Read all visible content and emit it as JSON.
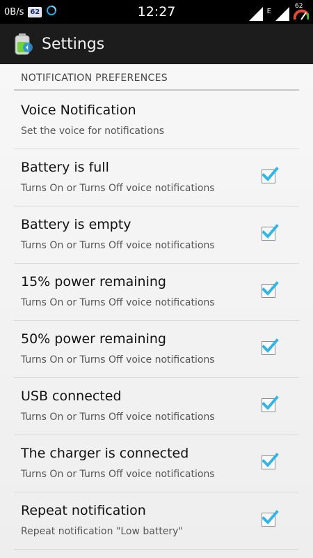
{
  "status_bar": {
    "net_speed": "0B/s",
    "badge": "62",
    "time": "12:27",
    "network_type": "E",
    "battery_level": "62"
  },
  "action_bar": {
    "title": "Settings",
    "icon": "battery-app-icon"
  },
  "section": {
    "header": "NOTIFICATION PREFERENCES"
  },
  "preferences": [
    {
      "title": "Voice Notification",
      "summary": "Set the voice for notifications",
      "has_checkbox": false
    },
    {
      "title": "Battery is full",
      "summary": "Turns On or Turns Off voice notifications",
      "has_checkbox": true,
      "checked": true
    },
    {
      "title": "Battery is empty",
      "summary": "Turns On or Turns Off voice notifications",
      "has_checkbox": true,
      "checked": true
    },
    {
      "title": "15% power remaining",
      "summary": "Turns On or Turns Off voice notifications",
      "has_checkbox": true,
      "checked": true
    },
    {
      "title": "50% power remaining",
      "summary": "Turns On or Turns Off voice notifications",
      "has_checkbox": true,
      "checked": true
    },
    {
      "title": "USB connected",
      "summary": "Turns On or Turns Off voice notifications",
      "has_checkbox": true,
      "checked": true
    },
    {
      "title": "The charger is connected",
      "summary": "Turns On or Turns Off voice notifications",
      "has_checkbox": true,
      "checked": true
    },
    {
      "title": "Repeat notification",
      "summary": "Repeat notification \"Low battery\"",
      "has_checkbox": true,
      "checked": true
    }
  ],
  "colors": {
    "accent": "#33b5e5",
    "action_bar": "#1c1c1c",
    "status_bar": "#000000"
  }
}
